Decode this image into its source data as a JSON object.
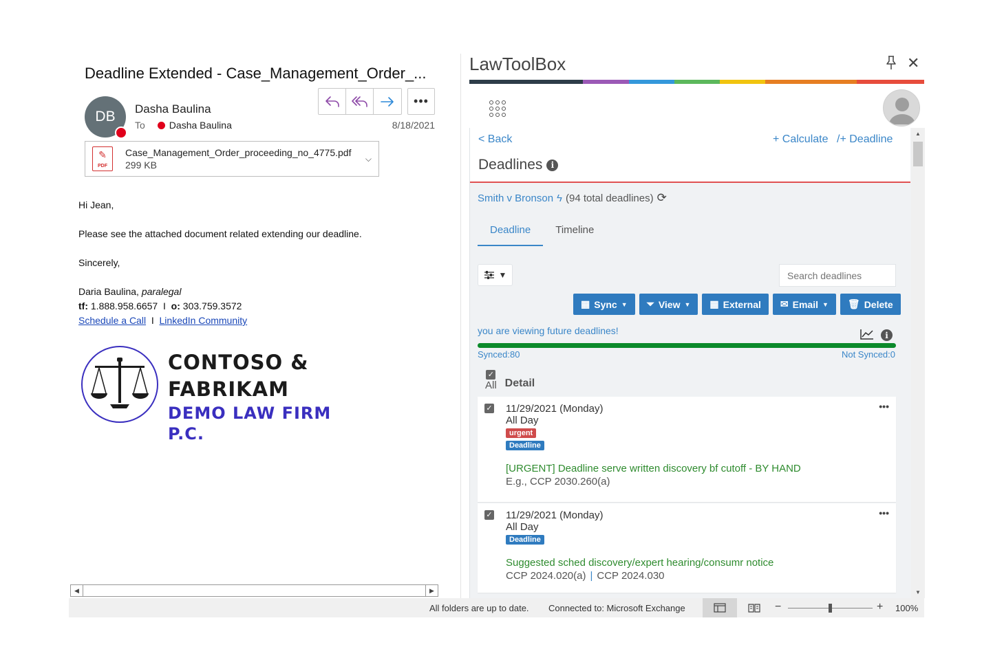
{
  "email": {
    "subject": "Deadline Extended - Case_Management_Order_...",
    "sender_initials": "DB",
    "sender_name": "Dasha Baulina",
    "to_label": "To",
    "to_name": "Dasha Baulina",
    "date": "8/18/2021",
    "more_label": "•••",
    "attachment": {
      "filename": "Case_Management_Order_proceeding_no_4775.pdf",
      "size": "299 KB",
      "type_label": "PDF"
    },
    "body": {
      "greeting": "Hi Jean,",
      "message": "Please see the attached document related extending our deadline.",
      "closing": "Sincerely,",
      "sig_name": "Daria Baulina,",
      "sig_title": "paralegal",
      "tf_label": "tf:",
      "tf_number": "1.888.958.6657",
      "o_label": "o:",
      "o_number": "303.759.3572",
      "separator": "I",
      "link_schedule": "Schedule a Call",
      "link_linkedin": "LinkedIn Community"
    },
    "logo": {
      "line1": "CONTOSO &",
      "line2": "FABRIKAM",
      "line3": "DEMO LAW FIRM P.C."
    }
  },
  "addin": {
    "title": "LawToolBox",
    "colorbar": [
      "#2e3d49",
      "#9b59b6",
      "#3498db",
      "#5cb85c",
      "#f1c40f",
      "#e67e22",
      "#e74c3c",
      "#c0392b"
    ],
    "back_label": "< Back",
    "calculate_label": "+ Calculate",
    "deadline_link_label": "/+ Deadline",
    "panel_title": "Deadlines",
    "matter_name": "Smith v Bronson",
    "matter_count": "(94 total deadlines)",
    "tabs": [
      {
        "label": "Deadline",
        "active": true
      },
      {
        "label": "Timeline",
        "active": false
      }
    ],
    "search_placeholder": "Search deadlines",
    "actions": {
      "sync": "Sync",
      "view": "View",
      "external": "External",
      "email": "Email",
      "delete": "Delete"
    },
    "future_message": "you are viewing future deadlines!",
    "synced_fraction": 1.0,
    "synced_label": "Synced:80",
    "not_synced_label": "Not Synced:0",
    "col_all": "All",
    "col_detail": "Detail",
    "deadlines": [
      {
        "date": "11/29/2021 (Monday)",
        "time": "All Day",
        "badge_urgent": "urgent",
        "badge_type": "Deadline",
        "description": "[URGENT] Deadline serve written discovery bf cutoff - BY HAND",
        "rule": "E.g., CCP 2030.260(a)"
      },
      {
        "date": "11/29/2021 (Monday)",
        "time": "All Day",
        "badge_type": "Deadline",
        "description": "Suggested sched discovery/expert hearing/consumr notice",
        "rule_a": "CCP 2024.020(a)",
        "rule_sep": "|",
        "rule_b": "CCP 2024.030"
      }
    ]
  },
  "statusbar": {
    "folders": "All folders are up to date.",
    "connection": "Connected to: Microsoft Exchange",
    "zoom": "100%",
    "zoom_minus": "−",
    "zoom_plus": "+"
  }
}
